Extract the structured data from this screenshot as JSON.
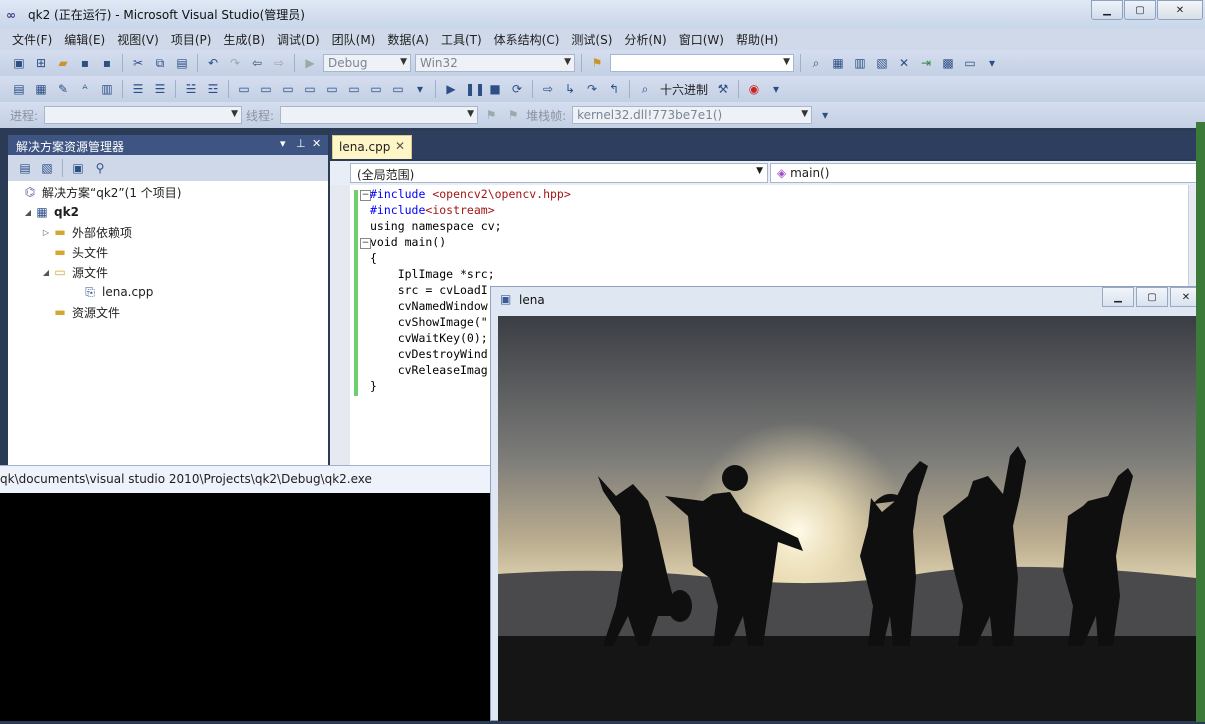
{
  "window": {
    "title": "qk2 (正在运行) - Microsoft Visual Studio(管理员)",
    "icon": "vs-infinity-icon",
    "buttons": [
      "minimize",
      "maximize",
      "close"
    ]
  },
  "menu": [
    "文件(F)",
    "编辑(E)",
    "视图(V)",
    "项目(P)",
    "生成(B)",
    "调试(D)",
    "团队(M)",
    "数据(A)",
    "工具(T)",
    "体系结构(C)",
    "测试(S)",
    "分析(N)",
    "窗口(W)",
    "帮助(H)"
  ],
  "toolbar1": {
    "config": "Debug",
    "platform": "Win32",
    "find_value": ""
  },
  "toolbar2": {
    "hex_label": "十六进制"
  },
  "toolbar3": {
    "process_label": "进程:",
    "thread_label": "线程:",
    "stackframe_label": "堆栈帧:",
    "stackframe_value": "kernel32.dll!773be7e1()"
  },
  "solution_explorer": {
    "header": "解决方案资源管理器",
    "tree": [
      {
        "label": "解决方案“qk2”(1 个项目)",
        "icon": "solution-icon"
      },
      {
        "label": "qk2",
        "icon": "project-icon"
      },
      {
        "label": "外部依赖项",
        "icon": "folder-icon"
      },
      {
        "label": "头文件",
        "icon": "folder-icon"
      },
      {
        "label": "源文件",
        "icon": "folder-open-icon"
      },
      {
        "label": "lena.cpp",
        "icon": "cpp-file-icon"
      },
      {
        "label": "资源文件",
        "icon": "folder-icon"
      }
    ]
  },
  "editor": {
    "tab": "lena.cpp",
    "scope": "(全局范围)",
    "member": "main()",
    "code": [
      {
        "pre": "#include ",
        "str": "<opencv2\\opencv.hpp>",
        "post": ""
      },
      {
        "pre": "#include",
        "str": "<iostream>",
        "post": ""
      },
      {
        "pre": "using namespace cv;",
        "str": "",
        "post": ""
      },
      {
        "pre": "void main()",
        "str": "",
        "post": ""
      },
      {
        "pre": "{",
        "str": "",
        "post": ""
      },
      {
        "pre": "    IplImage *src;",
        "str": "",
        "post": ""
      },
      {
        "pre": "    src = cvLoadI",
        "str": "",
        "post": ""
      },
      {
        "pre": "    cvNamedWindow",
        "str": "",
        "post": ""
      },
      {
        "pre": "    cvShowImage(\"",
        "str": "",
        "post": ""
      },
      {
        "pre": "    cvWaitKey(0);",
        "str": "",
        "post": ""
      },
      {
        "pre": "    cvDestroyWind",
        "str": "",
        "post": ""
      },
      {
        "pre": "    cvReleaseImag",
        "str": "",
        "post": ""
      },
      {
        "pre": "}",
        "str": "",
        "post": ""
      }
    ]
  },
  "console": {
    "title": "qk\\documents\\visual studio 2010\\Projects\\qk2\\Debug\\qk2.exe"
  },
  "image_window": {
    "title": "lena",
    "image": "silhouettes of five people raising arms at sunset"
  },
  "colors": {
    "vs_blue": "#2b3a55",
    "se_header": "#3e5482",
    "tab_yellow": "#fff6c7",
    "change_bar": "#6fcf6b",
    "keyword": "#0000ff",
    "string": "#a31515"
  }
}
